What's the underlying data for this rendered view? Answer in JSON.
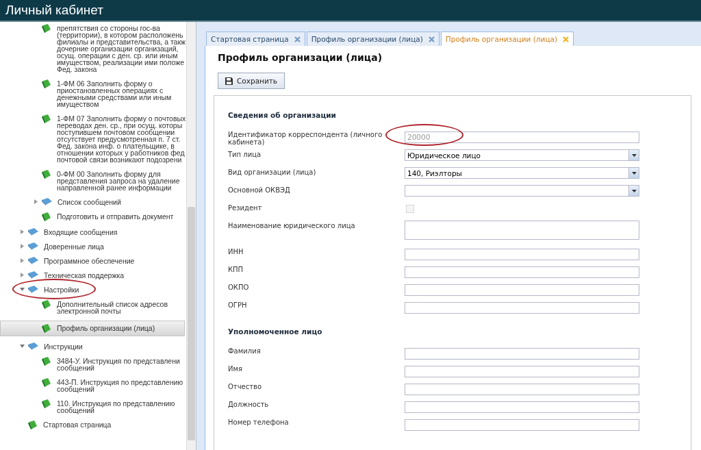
{
  "header": {
    "title": "Личный кабинет"
  },
  "sidebar": {
    "partial_branch": [
      {
        "kind": "document",
        "label": "препятствия со стороны гос-ва\n(территории), в котором расположень\nфилиалы и представительства, а такж\nдочерние организации организаций,\nосущ. операции с ден. ср. или иным\nимуществом, реализации ими положе\nФед. закона",
        "selected": false,
        "circled": false
      },
      {
        "kind": "document",
        "label": "1-ФМ 06 Заполнить форму о\nприостановленных операциях с\nденежными средствами или иным\nимуществом",
        "selected": false,
        "circled": false
      },
      {
        "kind": "document",
        "label": "1-ФМ 07 Заполнить форму о почтовых\nпереводах ден. ср., при осущ. которы\nпоступившем почтовом сообщении\nотсутствует предусмотренная п. 7 ст.\nФед. закона инф. о плательщике, в\nотношении которых у работников фед\nпочтовой связи возникают подозрени",
        "selected": false,
        "circled": false
      },
      {
        "kind": "document",
        "label": "0-ФМ 00 Заполнить форму для\nпредставления запроса на удаление\nнаправленной ранее информации",
        "selected": false,
        "circled": false
      },
      {
        "kind": "folder",
        "label": "Список сообщений",
        "expanded": false,
        "selected": false,
        "circled": false
      },
      {
        "kind": "document",
        "label": "Подготовить и отправить документ",
        "selected": false,
        "circled": false
      }
    ],
    "tree": [
      {
        "kind": "folder",
        "label": "Входящие сообщения",
        "expanded": false,
        "selected": false,
        "circled": false
      },
      {
        "kind": "folder",
        "label": "Доверенные лица",
        "expanded": false,
        "selected": false,
        "circled": false
      },
      {
        "kind": "folder",
        "label": "Программное обеспечение",
        "expanded": false,
        "selected": false,
        "circled": false
      },
      {
        "kind": "folder",
        "label": "Техническая поддержка",
        "expanded": false,
        "selected": false,
        "circled": false
      },
      {
        "kind": "folder",
        "label": "Настройки",
        "expanded": true,
        "selected": false,
        "circled": true,
        "children": [
          {
            "kind": "document",
            "label": "Дополнительный список адресов\nэлектронной почты",
            "selected": false,
            "circled": false
          },
          {
            "kind": "document",
            "label": "Профиль организации (лица)",
            "selected": true,
            "circled": false
          }
        ]
      },
      {
        "kind": "folder",
        "label": "Инструкции",
        "expanded": true,
        "selected": false,
        "circled": false,
        "children": [
          {
            "kind": "document",
            "label": "3484-У. Инструкция по представлени\nсообщений",
            "selected": false,
            "circled": false
          },
          {
            "kind": "document",
            "label": "443-П. Инструкция по представлению\nсообщений",
            "selected": false,
            "circled": false
          },
          {
            "kind": "document",
            "label": "110. Инструкция по представлению\nсообщений",
            "selected": false,
            "circled": false
          }
        ]
      },
      {
        "kind": "document",
        "label": "Стартовая страница",
        "selected": false,
        "circled": false
      }
    ]
  },
  "tabs": [
    {
      "label": "Стартовая страница",
      "selected": false
    },
    {
      "label": "Профиль организации (лица)",
      "selected": false
    },
    {
      "label": "Профиль организации (лица)",
      "selected": true
    }
  ],
  "page": {
    "title": "Профиль организации (лица)",
    "save_button": "Сохранить",
    "sections": [
      {
        "title": "Сведения об организации",
        "fields": [
          {
            "kind": "text",
            "label": "Идентификатор корреспондента (личного\nкабинета)",
            "value": "20000",
            "disabled": true,
            "circled": true
          },
          {
            "kind": "select",
            "label": "Тип лица",
            "value": "Юридическое лицо"
          },
          {
            "kind": "select",
            "label": "Вид организации (лица)",
            "value": "140, Риэлторы"
          },
          {
            "kind": "select",
            "label": "Основной ОКВЭД"
          },
          {
            "kind": "checkbox",
            "label": "Резидент",
            "checked": false,
            "disabled": true
          },
          {
            "kind": "textarea",
            "label": "Наименование юридического лица"
          },
          {
            "kind": "text",
            "label": "ИНН"
          },
          {
            "kind": "text",
            "label": "КПП"
          },
          {
            "kind": "text",
            "label": "ОКПО"
          },
          {
            "kind": "text",
            "label": "ОГРН"
          }
        ]
      },
      {
        "title": "Уполномоченное лицо",
        "fields": [
          {
            "kind": "text",
            "label": "Фамилия"
          },
          {
            "kind": "text",
            "label": "Имя"
          },
          {
            "kind": "text",
            "label": "Отчество"
          },
          {
            "kind": "text",
            "label": "Должность"
          },
          {
            "kind": "text",
            "label": "Номер телефона"
          }
        ]
      }
    ]
  }
}
